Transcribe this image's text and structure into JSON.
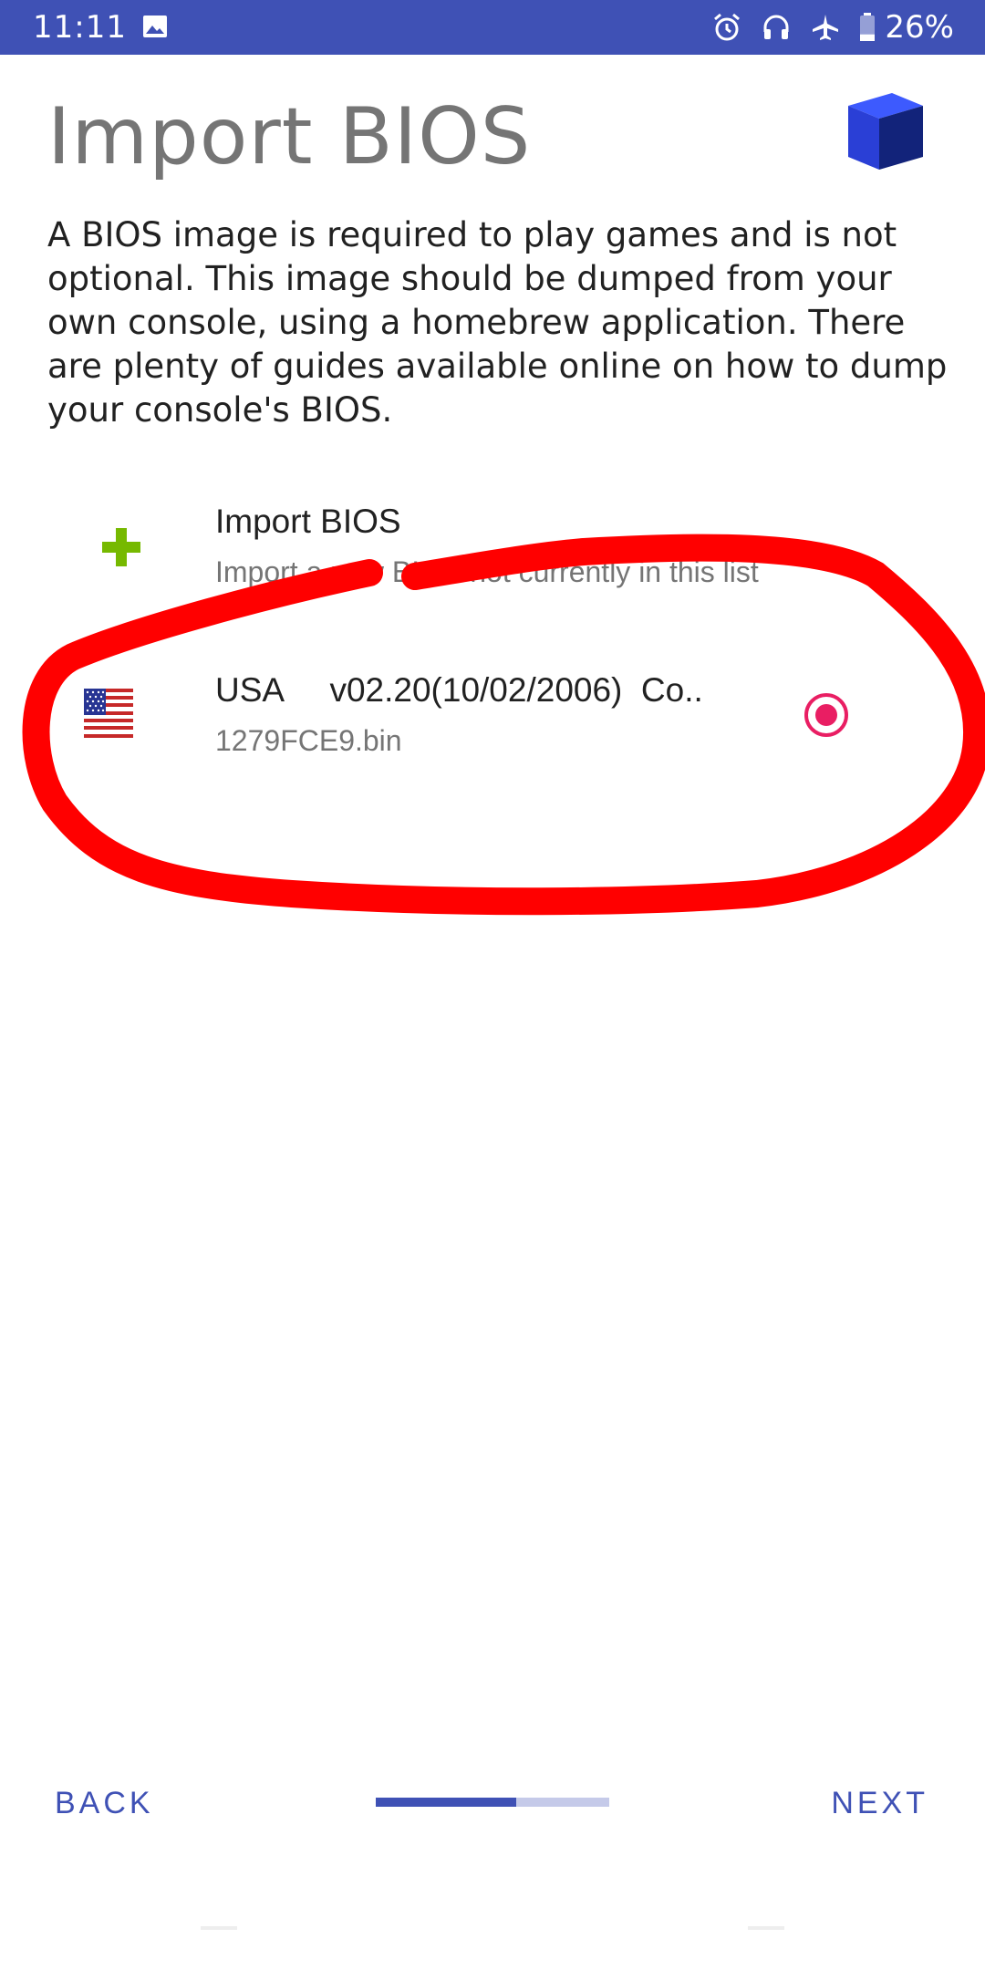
{
  "status_bar": {
    "time": "11:11",
    "battery_percent": "26%",
    "battery_level": 0.26,
    "icons": [
      "gallery-icon",
      "alarm-icon",
      "headset-icon",
      "airplane-mode-icon",
      "battery-icon"
    ],
    "background_color": "#3f51b5"
  },
  "header": {
    "title": "Import BIOS",
    "logo": "cube-logo-icon"
  },
  "description": "A BIOS image is required to play games and is not optional. This image should be dumped from your own console, using a homebrew application. There are plenty of guides available online on how to dump your console's BIOS.",
  "bios_list": {
    "import_item": {
      "icon": "plus-icon",
      "title": "Import BIOS",
      "subtitle": "Import a new BIOS not currently in this list"
    },
    "items": [
      {
        "icon": "us-flag-icon",
        "region": "USA",
        "version": "v02.20(10/02/2006)  Co..",
        "filename": "1279FCE9.bin",
        "selected": true
      }
    ]
  },
  "navigation": {
    "back_label": "BACK",
    "next_label": "NEXT",
    "progress": 0.6
  },
  "colors": {
    "accent": "#3f51b5",
    "accent_light": "#c5cae9",
    "radio_selected": "#e91e63",
    "plus_icon": "#76b900",
    "annotation": "#ff0000"
  }
}
